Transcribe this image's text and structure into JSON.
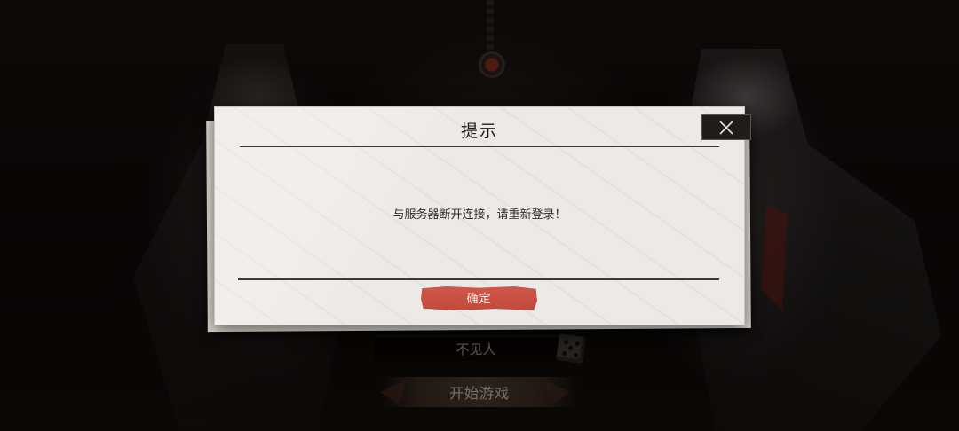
{
  "dialog": {
    "title": "提示",
    "message": "与服务器断开连接，请重新登录！",
    "confirm_label": "确定",
    "close_icon": "close-icon"
  },
  "background": {
    "player_name": "不见人",
    "start_button_label": "开始游戏",
    "dice_icon": "dice-icon"
  },
  "colors": {
    "dialog_paper": "#eceae6",
    "confirm_button": "#c94f42",
    "close_button": "#1f1d1c"
  }
}
